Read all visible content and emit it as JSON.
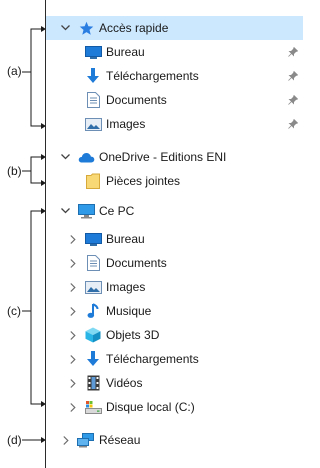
{
  "annotations": {
    "a": "(a)",
    "b": "(b)",
    "c": "(c)",
    "d": "(d)"
  },
  "quick_access": {
    "label": "Accès rapide",
    "items": [
      {
        "label": "Bureau",
        "icon": "desktop-icon"
      },
      {
        "label": "Téléchargements",
        "icon": "download-arrow-icon"
      },
      {
        "label": "Documents",
        "icon": "documents-icon"
      },
      {
        "label": "Images",
        "icon": "pictures-icon"
      }
    ]
  },
  "onedrive": {
    "label": "OneDrive - Editions ENI",
    "items": [
      {
        "label": "Pièces jointes",
        "icon": "folder-icon"
      }
    ]
  },
  "this_pc": {
    "label": "Ce PC",
    "items": [
      {
        "label": "Bureau",
        "icon": "desktop-icon"
      },
      {
        "label": "Documents",
        "icon": "documents-icon"
      },
      {
        "label": "Images",
        "icon": "pictures-icon"
      },
      {
        "label": "Musique",
        "icon": "music-icon"
      },
      {
        "label": "Objets 3D",
        "icon": "cube-3d-icon"
      },
      {
        "label": "Téléchargements",
        "icon": "download-arrow-icon"
      },
      {
        "label": "Vidéos",
        "icon": "video-icon"
      },
      {
        "label": "Disque local (C:)",
        "icon": "drive-icon"
      }
    ]
  },
  "network": {
    "label": "Réseau",
    "icon": "network-icon"
  },
  "colors": {
    "selected_bg": "#cce8ff",
    "accent_blue": "#1e88e5",
    "pin_gray": "#8a8a8a"
  }
}
